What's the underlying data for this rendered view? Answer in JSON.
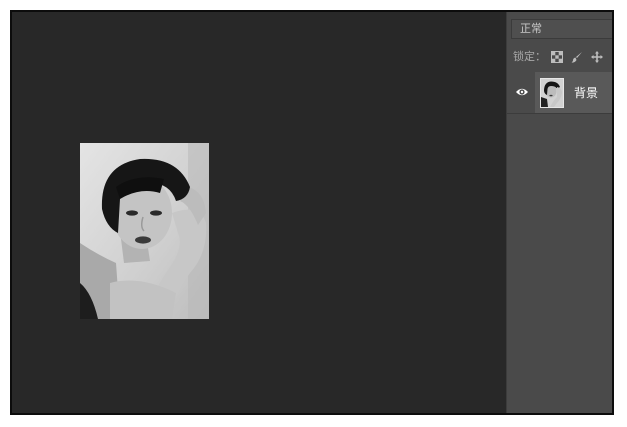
{
  "layers_panel": {
    "blend_mode": "正常",
    "lock_label": "锁定：",
    "lock_icons": [
      "lock-transparent-pixels-icon",
      "lock-image-pixels-icon",
      "lock-position-icon"
    ],
    "layers": [
      {
        "name": "背景",
        "visible": true,
        "thumbnail": "portrait-photo"
      }
    ]
  },
  "canvas": {
    "image": "grayscale-portrait-photo"
  },
  "colors": {
    "workspace": "#282828",
    "panel": "#4a4a4a",
    "layer_selected": "#595959",
    "frame_border": "#0c0c0c"
  }
}
